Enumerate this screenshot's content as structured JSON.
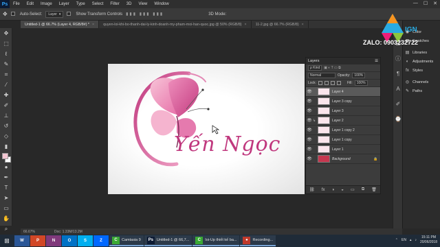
{
  "menubar": {
    "logo": "Ps",
    "items": [
      "File",
      "Edit",
      "Image",
      "Layer",
      "Type",
      "Select",
      "Filter",
      "3D",
      "View",
      "Window"
    ],
    "win_minimize": "—",
    "win_maximize": "☐",
    "win_close": "✕"
  },
  "options": {
    "auto_select_label": "Auto-Select:",
    "auto_select_value": "Layer",
    "show_transform_label": "Show Transform Controls",
    "mode_3d": "3D Mode:"
  },
  "tabs": [
    {
      "label": "Untitled-1 @ 66.7% (Layer 4, RGB/8#) *",
      "active": true
    },
    {
      "label": "quyen-loi-khi-bo-thanh-dai-ly-kinh-doanh-my-pham-moi-han-quoc.jpg @ 50% (RGB/8)",
      "active": false
    },
    {
      "label": "11-2.jpg @ 66.7% (RGB/8)",
      "active": false
    }
  ],
  "canvas": {
    "logo_text": "Yến Ngọc",
    "colors": {
      "pink_dark": "#c0387e",
      "pink_light": "#f3a9c7",
      "pink_mid": "#e06aa4"
    }
  },
  "watermark": {
    "zalo": "ZALO: 0903232722",
    "brand_fragment": "IGN"
  },
  "status": {
    "zoom": "66.67%",
    "doc": "Doc: 1.33M/13.2M"
  },
  "right_panel": {
    "items": [
      {
        "icon": "color-icon",
        "glyph": "◉",
        "label": "Color"
      },
      {
        "icon": "swatches-icon",
        "glyph": "▦",
        "label": "Swatches"
      },
      {
        "icon": "libraries-icon",
        "glyph": "▤",
        "label": "Libraries"
      },
      {
        "icon": "adjustments-icon",
        "glyph": "◐",
        "label": "Adjustments"
      },
      {
        "icon": "styles-icon",
        "glyph": "fx",
        "label": "Styles"
      },
      {
        "icon": "channels-icon",
        "glyph": "◎",
        "label": "Channels"
      },
      {
        "icon": "paths-icon",
        "glyph": "✎",
        "label": "Paths"
      }
    ]
  },
  "layers": {
    "title": "Layers",
    "kind_label": "ρ Kind",
    "blend_mode": "Normal",
    "opacity_label": "Opacity:",
    "opacity_value": "100%",
    "lock_label": "Lock:",
    "fill_label": "Fill:",
    "fill_value": "100%",
    "items": [
      {
        "name": "Layer 4",
        "active": true,
        "linked": false,
        "background": false
      },
      {
        "name": "Layer 3 copy",
        "active": false,
        "linked": false,
        "background": false
      },
      {
        "name": "Layer 3",
        "active": false,
        "linked": false,
        "background": false
      },
      {
        "name": "Layer 2",
        "active": false,
        "linked": true,
        "background": false
      },
      {
        "name": "Layer 1 copy 2",
        "active": false,
        "linked": false,
        "background": false
      },
      {
        "name": "Layer 1 copy",
        "active": false,
        "linked": false,
        "background": false
      },
      {
        "name": "Layer 1",
        "active": false,
        "linked": false,
        "background": false
      },
      {
        "name": "Background",
        "active": false,
        "linked": false,
        "background": true
      }
    ],
    "footer": [
      "⛓",
      "fx",
      "◑",
      "◒",
      "▭",
      "⧉",
      "🗑"
    ]
  },
  "taskbar": {
    "pinned": [
      {
        "label": "W",
        "color": "#2b5797"
      },
      {
        "label": "P",
        "color": "#d24726"
      },
      {
        "label": "N",
        "color": "#80397b"
      },
      {
        "label": "O",
        "color": "#0072c6"
      },
      {
        "label": "S",
        "color": "#00aff0"
      },
      {
        "label": "Z",
        "color": "#0068ff"
      }
    ],
    "apps": [
      {
        "label": "Camtasia 9",
        "icon": "C",
        "color": "#3aa935"
      },
      {
        "label": "Untitled-1 @ 66,7...",
        "icon": "Ps",
        "color": "#0c1a33"
      },
      {
        "label": "Ioi-Up thiết kế ba...",
        "icon": "C",
        "color": "#3aa935"
      },
      {
        "label": "Recording...",
        "icon": "●",
        "color": "#c0392b"
      }
    ],
    "tray_lang": "EN",
    "time": "15:11 PM",
    "date": "20/06/2018"
  }
}
